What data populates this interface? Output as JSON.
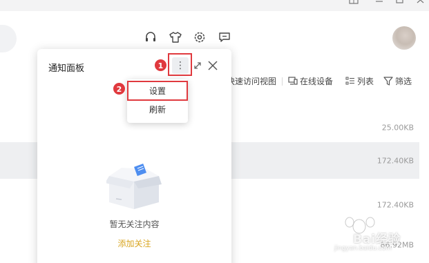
{
  "window": {
    "controls": [
      "window-icon",
      "minimize-icon",
      "restore-icon",
      "close-icon"
    ]
  },
  "header": {
    "icons": [
      "headset-icon",
      "tshirt-icon",
      "gear-icon",
      "chat-icon"
    ]
  },
  "toolbar": {
    "quick_view_label": "快速访问视图",
    "online_devices_label": "在线设备",
    "list_label": "列表",
    "filter_label": "筛选"
  },
  "files": {
    "rows": [
      {
        "size": "25.00KB",
        "selected": false
      },
      {
        "size": "172.40KB",
        "selected": true
      },
      {
        "size": "172.40KB",
        "selected": false
      },
      {
        "size": "86.92MB",
        "selected": false
      }
    ]
  },
  "panel": {
    "title": "通知面板",
    "more_label": "⋮",
    "empty_text": "暂无关注内容",
    "follow_link": "添加关注"
  },
  "menu": {
    "items": [
      {
        "label": "设置"
      },
      {
        "label": "刷新"
      }
    ]
  },
  "annotations": {
    "step1": "1",
    "step2": "2",
    "highlight_color": "#e0393e"
  },
  "watermark": {
    "brand": "Bai经验",
    "url": "jingyan.baidu.com"
  },
  "colors": {
    "accent_link": "#d8a520",
    "selected_row": "#eeeff1"
  }
}
